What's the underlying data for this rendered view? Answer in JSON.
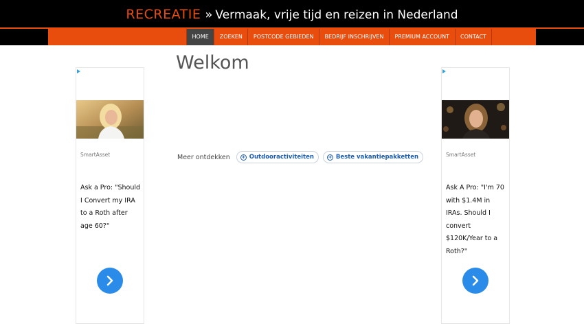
{
  "header": {
    "brand": "RECREATIE",
    "separator": "»",
    "tagline": "Vermaak, vrije tijd en reizen in Nederland"
  },
  "nav": {
    "items": [
      {
        "label": "HOME",
        "active": true
      },
      {
        "label": "ZOEKEN",
        "active": false
      },
      {
        "label": "POSTCODE GEBIEDEN",
        "active": false
      },
      {
        "label": "BEDRIJF INSCHRIJVEN",
        "active": false
      },
      {
        "label": "PREMIUM ACCOUNT",
        "active": false
      },
      {
        "label": "CONTACT",
        "active": false
      }
    ]
  },
  "main": {
    "title": "Welkom",
    "discover": {
      "label": "Meer ontdekken",
      "chips": [
        "Outdooractiviteiten",
        "Beste vakantiepakketten"
      ]
    }
  },
  "ads": {
    "left": {
      "source": "SmartAsset",
      "headline": "Ask a Pro: \"Should I Convert my IRA to a Roth after age 60?\""
    },
    "right": {
      "source": "SmartAsset",
      "headline": "Ask A Pro: \"I'm 70 with $1.4M in IRAs. Should I convert $120K/Year to a Roth?\""
    }
  },
  "colors": {
    "accent": "#e84d0e",
    "nav_active": "#444444",
    "chip_text": "#1a5cb0",
    "cta_blue": "#2a8be8"
  }
}
